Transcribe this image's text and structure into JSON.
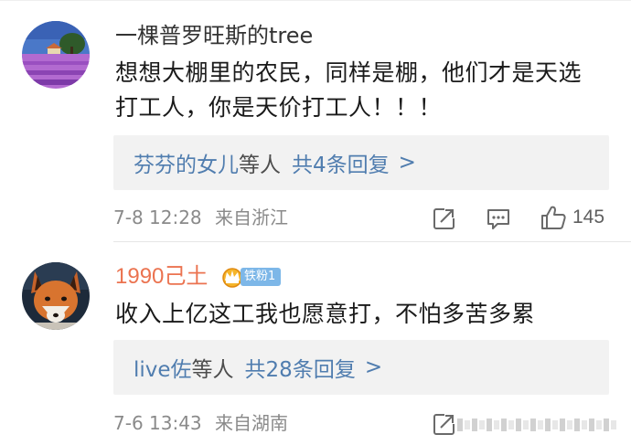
{
  "comments": [
    {
      "username": "一棵普罗旺斯的tree",
      "avatar_icon": "lavender-field-avatar",
      "text_lines": [
        "想想大棚里的农民，同样是棚，他们才是天选",
        "打工人，你是天价打工人！！！"
      ],
      "replies": {
        "names": "芬芬的女儿",
        "etc": "等人",
        "total": "共4条回复",
        "arrow": ">"
      },
      "time": "7-8 12:28",
      "location": "来自浙江",
      "likes": "145",
      "icons": [
        "share-icon",
        "comment-icon",
        "like-icon"
      ]
    },
    {
      "username": "1990己土",
      "avatar_icon": "fox-avatar",
      "badge": "铁粉1",
      "badge_icon": "crown-icon",
      "text_lines": [
        "收入上亿这工我也愿意打，不怕多苦多累"
      ],
      "replies": {
        "names": "live佐",
        "etc": "等人",
        "total": "共28条回复",
        "arrow": ">"
      },
      "time": "7-6 13:43",
      "location": "来自湖南",
      "icons": [
        "share-icon"
      ]
    }
  ],
  "colors": {
    "username_default": "#333333",
    "username_fan": "#eb7350",
    "link_blue": "#507daf",
    "meta_gray": "#8a8a8a",
    "reply_bg": "#f2f2f2",
    "badge_blue": "#7db7e8"
  }
}
